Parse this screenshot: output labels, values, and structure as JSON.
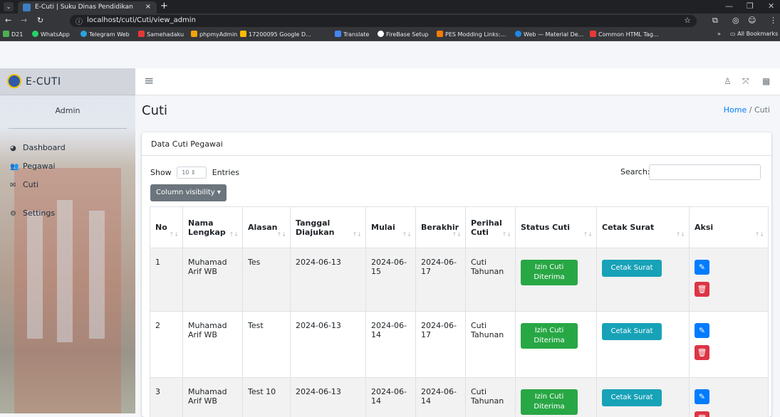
{
  "browser": {
    "tab_title": "E-Cuti | Suku Dinas Pendidikan",
    "tab_close": "×",
    "new_tab": "+",
    "url": "localhost/cuti/Cuti/view_admin",
    "bookmarks": [
      "D21",
      "WhatsApp",
      "Telegram Web",
      "Samehadaku",
      "phpmyAdmin",
      "17200095 Google D...",
      "Translate",
      "FireBase Setup",
      "PES Modding Links:...",
      "Web — Material De...",
      "Common HTML Tag..."
    ],
    "all_bookmarks": "All Bookmarks",
    "more_bookmarks": "»"
  },
  "app": {
    "brand": "E-CUTI",
    "user": "Admin",
    "menu": [
      {
        "label": "Dashboard",
        "icon": "dashboard-icon"
      },
      {
        "label": "Pegawai",
        "icon": "users-icon"
      },
      {
        "label": "Cuti",
        "icon": "envelope-icon"
      },
      {
        "label": "Settings",
        "icon": "gear-icon"
      }
    ]
  },
  "page": {
    "title": "Cuti",
    "breadcrumb_home": "Home",
    "breadcrumb_sep": "/",
    "breadcrumb_current": "Cuti"
  },
  "card": {
    "title": "Data Cuti Pegawai",
    "show_label": "Show",
    "length_value": "10",
    "entries_label": "Entries",
    "search_label": "Search:",
    "search_value": "",
    "colvis_label": "Column visibility"
  },
  "table": {
    "headers": [
      "No",
      "Nama Lengkap",
      "Alasan",
      "Tanggal Diajukan",
      "Mulai",
      "Berakhir",
      "Perihal Cuti",
      "Status Cuti",
      "Cetak Surat",
      "Aksi"
    ],
    "rows": [
      {
        "no": "1",
        "nama": "Muhamad Arif WB",
        "alasan": "Tes",
        "tanggal": "2024-06-13",
        "mulai": "2024-06-15",
        "berakhir": "2024-06-17",
        "perihal": "Cuti Tahunan",
        "status": "Izin Cuti Diterima",
        "cetak": "Cetak Surat"
      },
      {
        "no": "2",
        "nama": "Muhamad Arif WB",
        "alasan": "Test",
        "tanggal": "2024-06-13",
        "mulai": "2024-06-14",
        "berakhir": "2024-06-17",
        "perihal": "Cuti Tahunan",
        "status": "Izin Cuti Diterima",
        "cetak": "Cetak Surat"
      },
      {
        "no": "3",
        "nama": "Muhamad Arif WB",
        "alasan": "Test 10",
        "tanggal": "2024-06-13",
        "mulai": "2024-06-14",
        "berakhir": "2024-06-14",
        "perihal": "Cuti Tahunan",
        "status": "Izin Cuti Diterima",
        "cetak": "Cetak Surat"
      }
    ]
  },
  "colors": {
    "success": "#28a745",
    "info": "#17a2b8",
    "primary": "#007bff",
    "danger": "#dc3545",
    "secondary": "#6c757d"
  }
}
